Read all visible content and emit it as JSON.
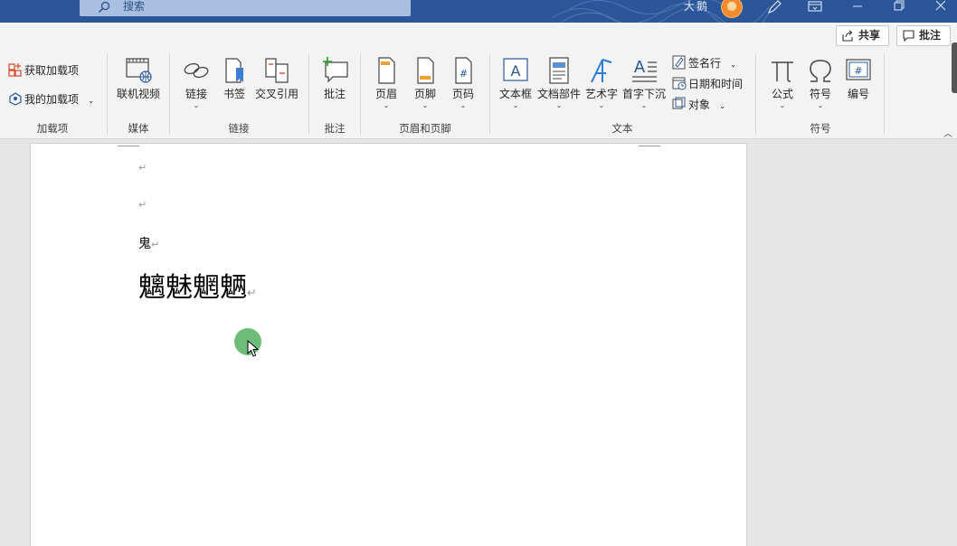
{
  "titlebar": {
    "search_placeholder": "搜索",
    "username": "大鹅"
  },
  "ribbon_right": {
    "share_label": "共享",
    "comment_label": "批注"
  },
  "groups": {
    "addins": {
      "label": "加载项",
      "get_addins": "获取加载项",
      "my_addins": "我的加载项"
    },
    "media": {
      "label": "媒体",
      "online_video": "联机视频"
    },
    "links": {
      "label": "链接",
      "link": "链接",
      "bookmark": "书签",
      "cross_ref": "交叉引用"
    },
    "comments": {
      "label": "批注",
      "comment": "批注"
    },
    "header_footer": {
      "label": "页眉和页脚",
      "header": "页眉",
      "footer": "页脚",
      "page_number": "页码"
    },
    "text": {
      "label": "文本",
      "textbox": "文本框",
      "quick_parts": "文档部件",
      "wordart": "艺术字",
      "dropcap": "首字下沉",
      "signature_line": "签名行",
      "date_time": "日期和时间",
      "object": "对象"
    },
    "symbols": {
      "label": "符号",
      "equation": "公式",
      "symbol": "符号",
      "number": "编号"
    }
  },
  "document": {
    "paragraphs": [
      "",
      "",
      "鬼",
      "魑魅魍魉"
    ],
    "paragraph_mark": "↵"
  },
  "colors": {
    "titlebar": "#2b579a",
    "ribbon": "#f3f3f3",
    "accent_orange": "#d24726",
    "cursor_highlight": "#5fb46a"
  }
}
